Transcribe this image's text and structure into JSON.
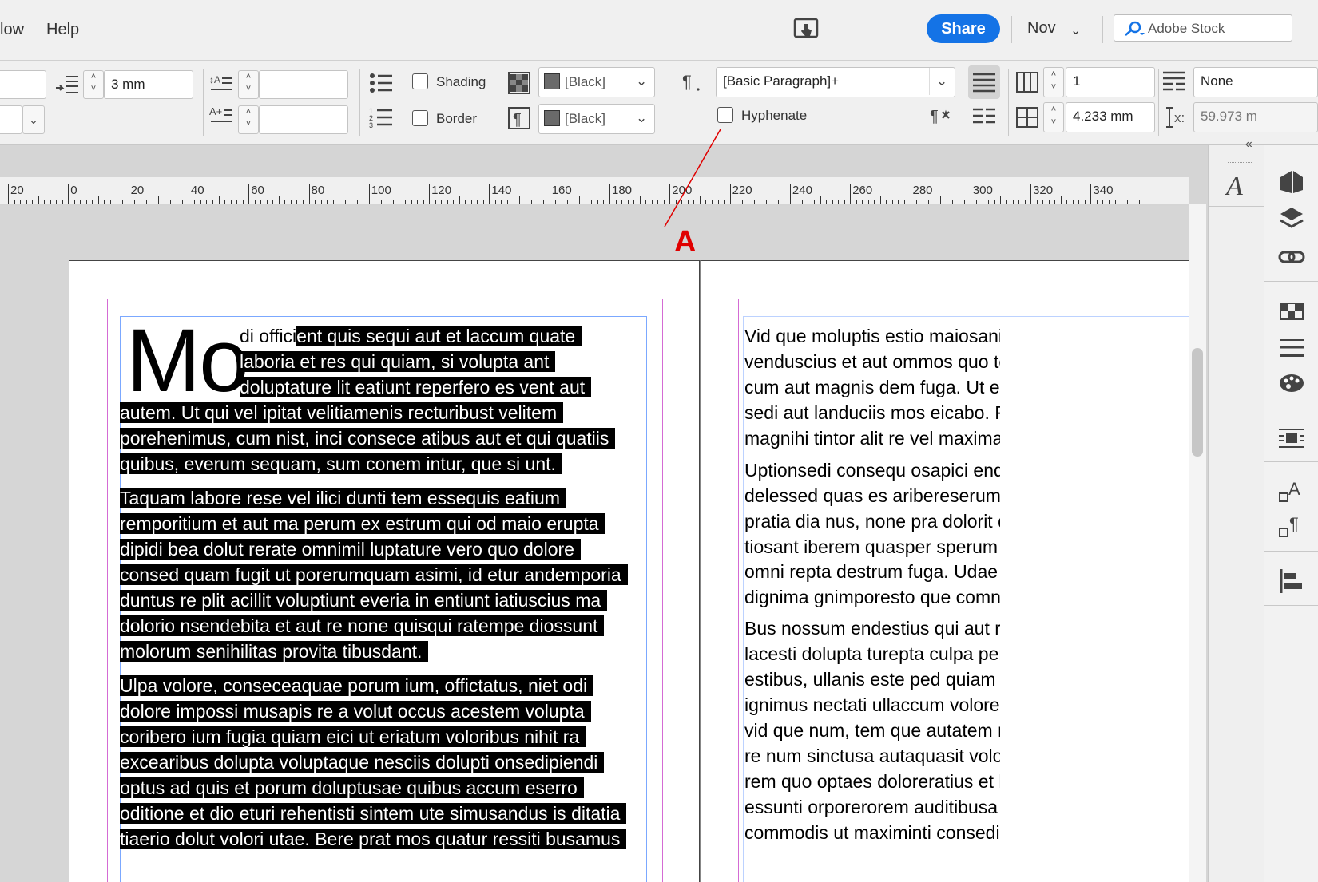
{
  "menu": {
    "items": [
      "low",
      "Help"
    ],
    "share": "Share",
    "workspace": "Nov",
    "stock_placeholder": "Adobe Stock"
  },
  "control": {
    "space_after": "3 mm",
    "shading_label": "Shading",
    "border_label": "Border",
    "shading_color": "[Black]",
    "border_color": "[Black]",
    "paragraph_style": "[Basic Paragraph]+",
    "hyphenate_label": "Hyphenate",
    "columns": "1",
    "gutter": "4.233 mm",
    "span_none": "None",
    "x_value": "59.973 m",
    "x_label": "x:"
  },
  "ruler": {
    "labels": [
      "20",
      "0",
      "20",
      "40",
      "60",
      "80",
      "100",
      "120",
      "140",
      "160",
      "180",
      "200",
      "220",
      "240",
      "260",
      "280",
      "300",
      "320",
      "340"
    ]
  },
  "annotation": "A",
  "left_story": {
    "dropcap": "Mo",
    "first_line_plain": "di offici",
    "first_line_hl": "ent quis sequi aut et laccum quate",
    "lines": [
      "laboria et res qui quiam, si volupta ant",
      "doluptature lit eatiunt reperfero es vent aut",
      "autem. Ut qui vel ipitat velitiamenis recturibust velitem",
      "porehenimus, cum nist, inci consece atibus aut et qui quatiis",
      "quibus, everum sequam, sum conem intur, que si unt.",
      "Taquam labore rese vel ilici dunti tem essequis eatium",
      "remporitium et aut ma perum ex estrum qui od maio erupta",
      "dipidi bea dolut rerate omnimil luptature vero quo dolore",
      "consed quam fugit ut porerumquam asimi, id etur andemporia",
      "duntus re plit acillit voluptiunt everia in entiunt iatiuscius ma",
      "dolorio nsendebita et aut re none quisqui ratempe diossunt",
      "molorum senihilitas provita tibusdant.",
      "Ulpa volore, conseceaquae porum ium, offictatus, niet odi",
      "dolore impossi musapis re a volut occus acestem volupta",
      "coribero ium fugia quiam eici ut eriatum voloribus nihit ra",
      "excearibus dolupta voluptaque nesciis dolupti onsedipiendi",
      "optus ad quis et porum doluptusae quibus accum eserro",
      "oditione et dio eturi rehentisti sintem ute simusandus is ditatia",
      "tiaerio dolut volori utae. Bere prat mos quatur ressiti busamus"
    ]
  },
  "right_story": {
    "lines": [
      "Vid que moluptis estio maiosanimus rem cons",
      "venduscius et aut ommos quo tem viducimagr",
      "cum aut magnis dem fuga. Ut eium quodi re si",
      "sedi aut landuciis mos eicabo. Ra idias sit atis e",
      "magnihi tintor alit re vel maximagnam alitat.",
      "Uptionsedi consequ osapici endam, quos dolc",
      "delessed quas es aribereserum re peligeni vitir",
      "pratia dia nus, none pra dolorit quaspedi neca",
      "tiosant iberem quasper sperum aut lam con p",
      "omni repta destrum fuga. Udae nonsequatint",
      "dignima gnimporesto que comnita tibus.",
      "Bus nossum endestius qui aut reium quodisq u",
      "lacesti dolupta turepta culpa peria asitatquate",
      "estibus, ullanis este ped quiam simaximint la q",
      "ignimus nectati ullaccum voloressit evelitibust,",
      "vid que num, tem que autatem rae ressimusar",
      "re num sinctusa autaquasit voloruptate ame n",
      "rem quo optaes doloreratius et lat porem nat",
      "essunti orporerorem auditibusa id ullatiis rem",
      "commodis ut maximinti consedi sa con ped m"
    ]
  },
  "colors": {
    "accent": "#1473e6",
    "annotation": "#e00000",
    "margin": "#d46bd4",
    "frame": "#7ba8ff"
  }
}
